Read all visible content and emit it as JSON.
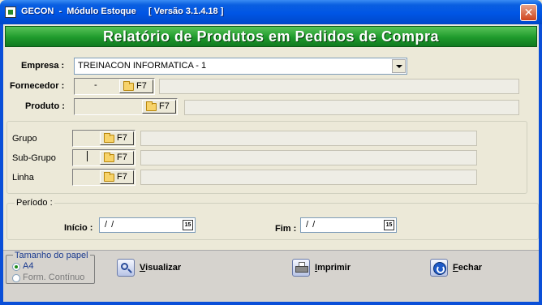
{
  "window": {
    "title": "GECON  -  Módulo Estoque     [ Versão 3.1.4.18 ]",
    "close_glyph": "✕"
  },
  "banner": {
    "title": "Relatório de Produtos em Pedidos de Compra"
  },
  "form": {
    "empresa": {
      "label": "Empresa :",
      "value": "TREINACON INFORMATICA - 1"
    },
    "fornecedor": {
      "label": "Fornecedor :",
      "code": "-",
      "lookup_label": "F7",
      "description": ""
    },
    "produto": {
      "label": "Produto :",
      "code": "",
      "lookup_label": "F7",
      "description": ""
    }
  },
  "classification": {
    "grupo": {
      "label": "Grupo",
      "code": "",
      "lookup_label": "F7",
      "description": ""
    },
    "subgrupo": {
      "label": "Sub-Grupo",
      "code": "",
      "lookup_label": "F7",
      "description": ""
    },
    "linha": {
      "label": "Linha",
      "code": "",
      "lookup_label": "F7",
      "description": ""
    }
  },
  "period": {
    "title": "Período :",
    "inicio": {
      "label": "Início :",
      "value": "/ /",
      "cal_text": "15"
    },
    "fim": {
      "label": "Fim :",
      "value": "/ /",
      "cal_text": "15"
    }
  },
  "paper_size": {
    "title": "Tamanho do papel",
    "options": [
      {
        "label": "A4",
        "selected": true
      },
      {
        "label": "Form. Contínuo",
        "selected": false
      }
    ]
  },
  "actions": {
    "visualizar": {
      "label_first": "V",
      "label_rest": "isualizar",
      "icon": "magnifier-icon"
    },
    "imprimir": {
      "label_first": "I",
      "label_rest": "mprimir",
      "icon": "printer-icon"
    },
    "fechar": {
      "label_first": "F",
      "label_rest": "echar",
      "icon": "power-icon"
    }
  },
  "colors": {
    "titlebar": "#0055E5",
    "banner": "#1F9A2C",
    "background": "#ECE9D8"
  }
}
